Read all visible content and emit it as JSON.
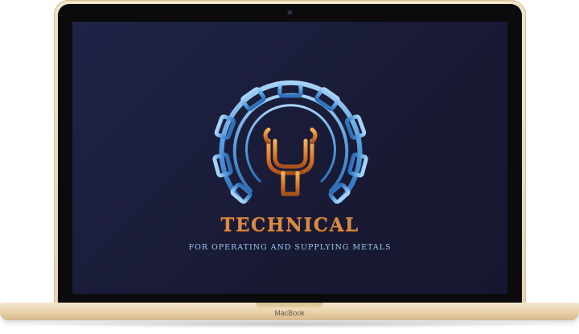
{
  "device": {
    "base_label": "MacBook",
    "frame_color": "#ead5ae",
    "screen_color": "#1b1d3a"
  },
  "brand": {
    "title": "TECHNICAL",
    "subtitle": "FOR OPERATING AND SUPPLYING METALS",
    "logo_icon": "gear-wrench-h-logo",
    "title_color": "#d98a44",
    "subtitle_color": "#9fc8ec",
    "gear_color": "#5aa0e0"
  }
}
